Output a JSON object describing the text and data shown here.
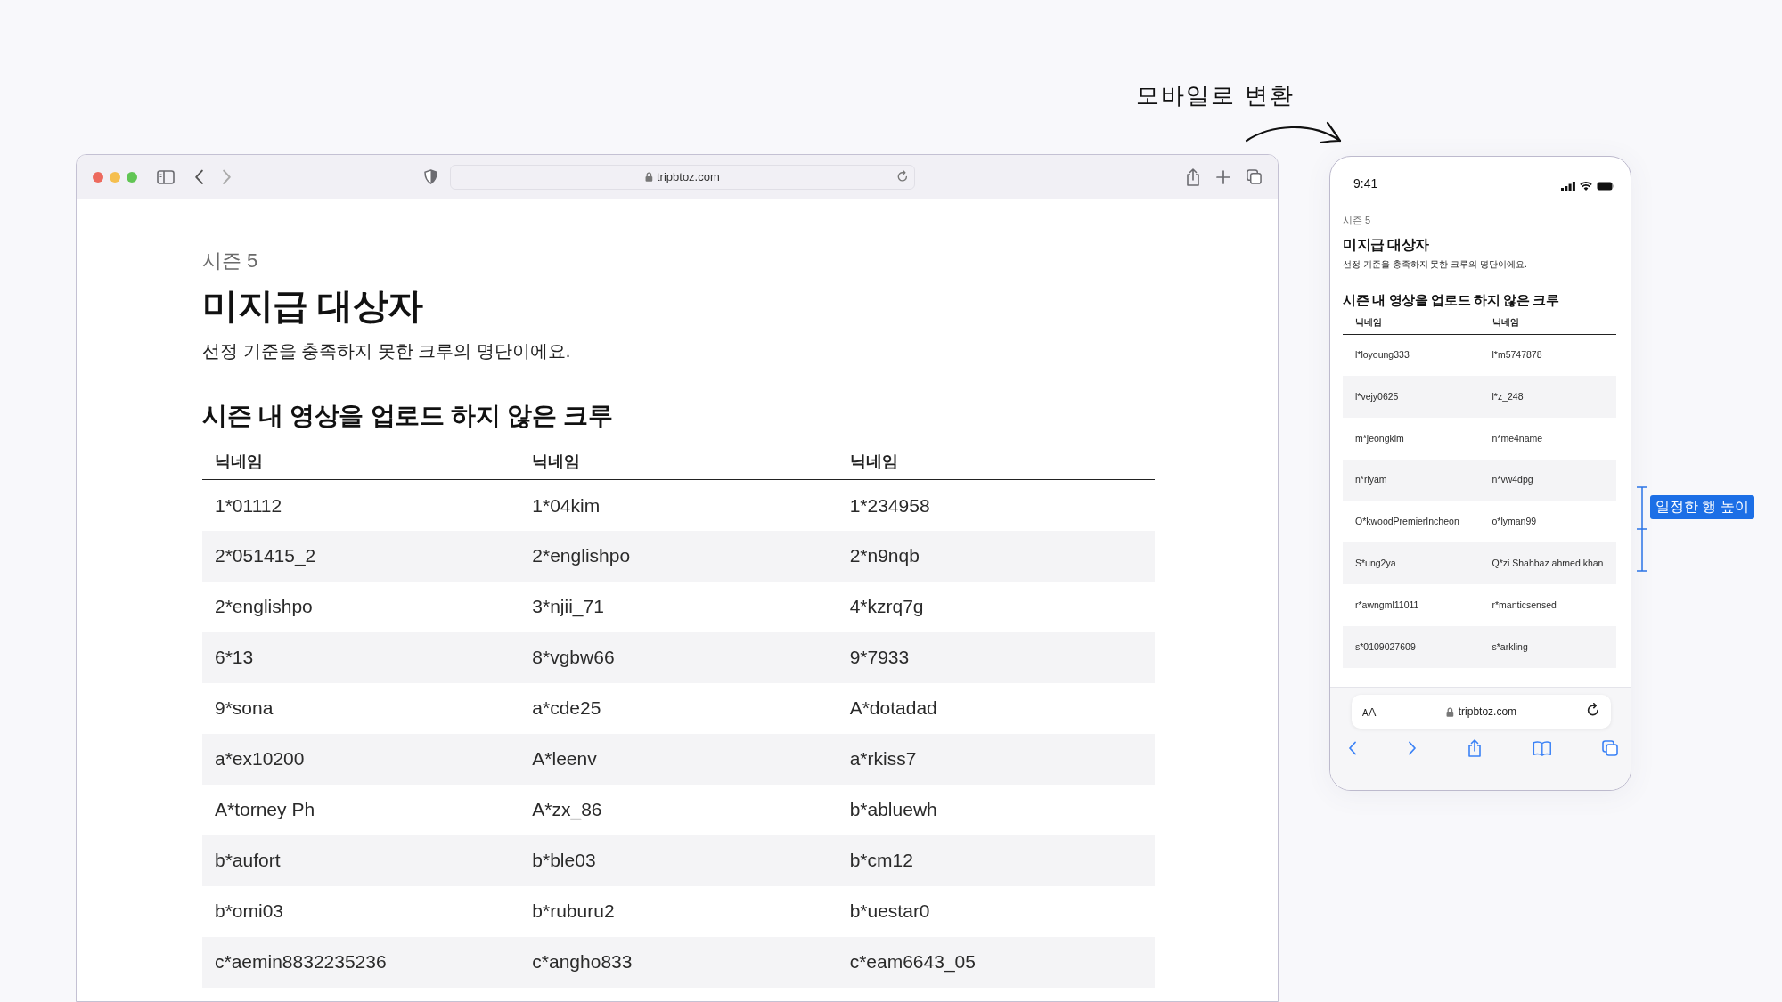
{
  "annotation": {
    "text": "모바일로 변환"
  },
  "desktop": {
    "url": "tripbtoz.com",
    "page": {
      "season": "시즌 5",
      "title": "미지급 대상자",
      "subtitle": "선정 기준을 충족하지 못한 크루의 명단이에요.",
      "section": "시즌 내 영상을 업로드 하지 않은 크루",
      "columns": [
        "닉네임",
        "닉네임",
        "닉네임"
      ],
      "rows": [
        [
          "1*01112",
          "1*04kim",
          "1*234958"
        ],
        [
          "2*051415_2",
          "2*englishpo",
          "2*n9nqb"
        ],
        [
          "2*englishpo",
          "3*njii_71",
          "4*kzrq7g"
        ],
        [
          "6*13",
          "8*vgbw66",
          "9*7933"
        ],
        [
          "9*sona",
          "a*cde25",
          "A*dotadad"
        ],
        [
          "a*ex10200",
          "A*leenv",
          "a*rkiss7"
        ],
        [
          "A*torney Ph",
          "A*zx_86",
          "b*abluewh"
        ],
        [
          "b*aufort",
          "b*ble03",
          "b*cm12"
        ],
        [
          "b*omi03",
          "b*ruburu2",
          "b*uestar0"
        ],
        [
          "c*aemin8832235236",
          "c*angho833",
          "c*eam6643_05"
        ]
      ]
    }
  },
  "mobile": {
    "time": "9:41",
    "url": "tripbtoz.com",
    "text_size": "AA",
    "page": {
      "season": "시즌 5",
      "title": "미지급 대상자",
      "subtitle": "선정 기준을 충족하지 못한 크루의 명단이에요.",
      "section": "시즌 내 영상을 업로드 하지 않은 크루",
      "columns": [
        "닉네임",
        "닉네임"
      ],
      "rows": [
        [
          "l*loyoung333",
          "l*m5747878"
        ],
        [
          "l*vejy0625",
          "l*z_248"
        ],
        [
          "m*jeongkim",
          "n*me4name"
        ],
        [
          "n*riyam",
          "n*vw4dpg"
        ],
        [
          "O*kwoodPremierIncheon",
          "o*lyman99"
        ],
        [
          "S*ung2ya",
          "Q*zi Shahbaz ahmed khan"
        ],
        [
          "r*awngml11011",
          "r*manticsensed"
        ],
        [
          "s*0109027609",
          "s*arkling"
        ]
      ]
    }
  },
  "callout": {
    "text": "일정한 행 높이"
  }
}
